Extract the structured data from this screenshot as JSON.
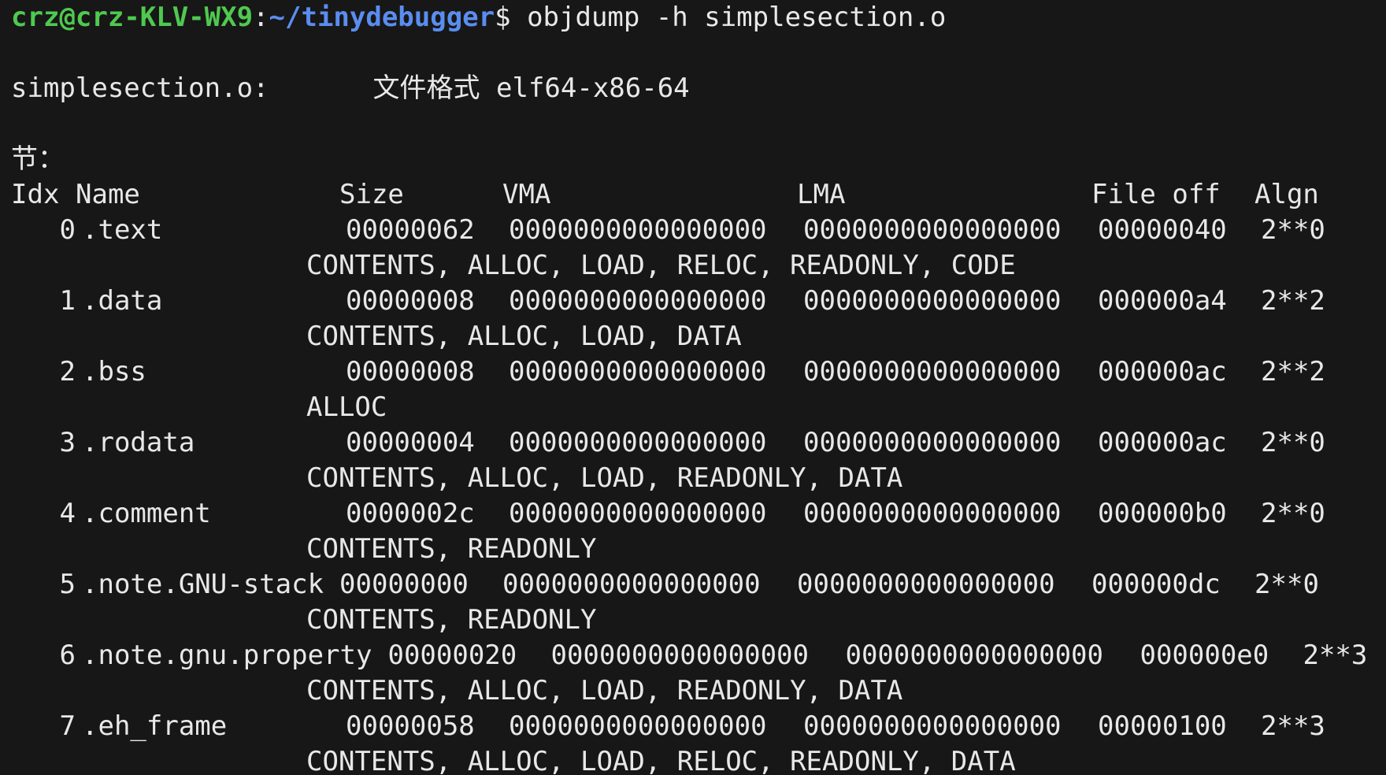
{
  "prompt": {
    "user_host": "crz@crz-KLV-WX9",
    "separator": ":",
    "path": "~/tinydebugger",
    "symbol": "$",
    "command": "objdump -h simplesection.o"
  },
  "file_header": {
    "filename": "simplesection.o:",
    "format_label": "文件格式",
    "format_value": "elf64-x86-64"
  },
  "sections_label": "节：",
  "columns": {
    "idx": "Idx",
    "name": "Name",
    "size": "Size",
    "vma": "VMA",
    "lma": "LMA",
    "file_off": "File off",
    "algn": "Algn"
  },
  "sections": [
    {
      "idx": "0",
      "name": ".text",
      "size": "00000062",
      "vma": "0000000000000000",
      "lma": "0000000000000000",
      "file_off": "00000040",
      "algn": "2**0",
      "flags": "CONTENTS, ALLOC, LOAD, RELOC, READONLY, CODE"
    },
    {
      "idx": "1",
      "name": ".data",
      "size": "00000008",
      "vma": "0000000000000000",
      "lma": "0000000000000000",
      "file_off": "000000a4",
      "algn": "2**2",
      "flags": "CONTENTS, ALLOC, LOAD, DATA"
    },
    {
      "idx": "2",
      "name": ".bss",
      "size": "00000008",
      "vma": "0000000000000000",
      "lma": "0000000000000000",
      "file_off": "000000ac",
      "algn": "2**2",
      "flags": "ALLOC"
    },
    {
      "idx": "3",
      "name": ".rodata",
      "size": "00000004",
      "vma": "0000000000000000",
      "lma": "0000000000000000",
      "file_off": "000000ac",
      "algn": "2**0",
      "flags": "CONTENTS, ALLOC, LOAD, READONLY, DATA"
    },
    {
      "idx": "4",
      "name": ".comment",
      "size": "0000002c",
      "vma": "0000000000000000",
      "lma": "0000000000000000",
      "file_off": "000000b0",
      "algn": "2**0",
      "flags": "CONTENTS, READONLY"
    },
    {
      "idx": "5",
      "name": ".note.GNU-stack",
      "size": "00000000",
      "vma": "0000000000000000",
      "lma": "0000000000000000",
      "file_off": "000000dc",
      "algn": "2**0",
      "flags": "CONTENTS, READONLY"
    },
    {
      "idx": "6",
      "name": ".note.gnu.property",
      "size": "00000020",
      "vma": "0000000000000000",
      "lma": "0000000000000000",
      "file_off": "000000e0",
      "algn": "2**3",
      "flags": "CONTENTS, ALLOC, LOAD, READONLY, DATA"
    },
    {
      "idx": "7",
      "name": ".eh_frame",
      "size": "00000058",
      "vma": "0000000000000000",
      "lma": "0000000000000000",
      "file_off": "00000100",
      "algn": "2**3",
      "flags": "CONTENTS, ALLOC, LOAD, RELOC, READONLY, DATA"
    }
  ],
  "colors": {
    "background": "#171717",
    "text": "#e8e8e8",
    "prompt_user": "#4fc94f",
    "prompt_path": "#5a8df0"
  }
}
